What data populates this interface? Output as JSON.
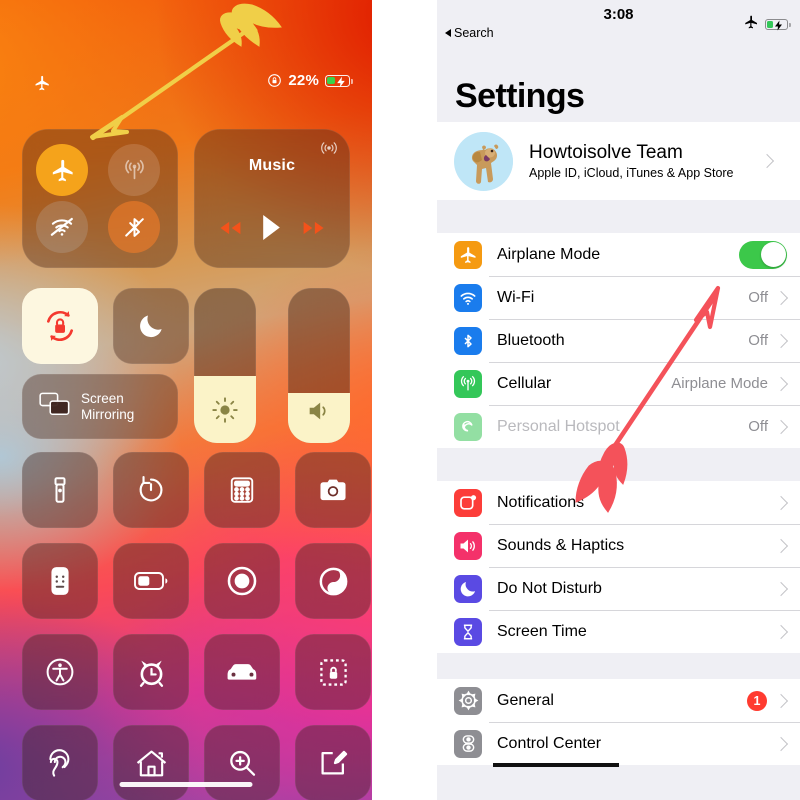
{
  "control_center": {
    "status_bar": {
      "airplane_icon": "airplane-icon",
      "orientation_lock_icon": "rotation-lock-icon",
      "battery_percent": "22%",
      "battery_icon": "battery-charging-icon"
    },
    "connectivity": {
      "airplane": {
        "name": "airplane-mode-toggle",
        "icon": "airplane-icon",
        "state": "on"
      },
      "cellular": {
        "name": "cellular-data-toggle",
        "icon": "cellular-antenna-icon",
        "state": "off"
      },
      "wifi": {
        "name": "wifi-toggle",
        "icon": "wifi-off-icon",
        "state": "off"
      },
      "bluetooth": {
        "name": "bluetooth-toggle",
        "icon": "bluetooth-off-icon",
        "state": "off"
      }
    },
    "music": {
      "title": "Music",
      "airplay_icon": "airplay-audio-icon",
      "rewind_icon": "rewind-icon",
      "play_icon": "play-icon",
      "forward_icon": "fast-forward-icon"
    },
    "tiles": {
      "rotation_lock": "rotation-lock-icon",
      "do_not_disturb": "moon-icon",
      "screen_mirroring_label_line1": "Screen",
      "screen_mirroring_label_line2": "Mirroring",
      "brightness_icon": "brightness-sun-icon",
      "volume_icon": "speaker-icon",
      "brightness_level": 43,
      "volume_level": 32
    },
    "grid": [
      {
        "name": "flashlight-tile",
        "icon": "flashlight-icon"
      },
      {
        "name": "timer-tile",
        "icon": "timer-icon"
      },
      {
        "name": "calculator-tile",
        "icon": "calculator-icon"
      },
      {
        "name": "camera-tile",
        "icon": "camera-icon"
      },
      {
        "name": "apple-tv-remote-tile",
        "icon": "remote-icon"
      },
      {
        "name": "low-power-mode-tile",
        "icon": "battery-icon"
      },
      {
        "name": "screen-record-tile",
        "icon": "record-icon"
      },
      {
        "name": "dark-mode-tile",
        "icon": "contrast-icon"
      },
      {
        "name": "accessibility-tile",
        "icon": "accessibility-icon"
      },
      {
        "name": "alarm-tile",
        "icon": "alarm-clock-icon"
      },
      {
        "name": "driving-focus-tile",
        "icon": "car-icon"
      },
      {
        "name": "guided-access-tile",
        "icon": "lock-dashed-icon"
      },
      {
        "name": "hearing-tile",
        "icon": "ear-icon"
      },
      {
        "name": "home-tile",
        "icon": "home-icon"
      },
      {
        "name": "magnifier-tile",
        "icon": "magnifier-plus-icon"
      },
      {
        "name": "notes-tile",
        "icon": "notes-pencil-icon"
      }
    ],
    "annotation": {
      "name": "yellow-arrow-annotation",
      "color": "#f2d24b",
      "points_to": "airplane-mode-toggle"
    },
    "home_indicator": "home-indicator"
  },
  "settings": {
    "status_bar": {
      "time": "3:08",
      "back_label": "Search",
      "airplane_icon": "airplane-icon",
      "battery_icon": "battery-charging-icon"
    },
    "page_title": "Settings",
    "account": {
      "name": "Howtoisolve Team",
      "subtitle": "Apple ID, iCloud, iTunes & App Store",
      "avatar": "giraffe-memoji-avatar"
    },
    "group_connectivity": [
      {
        "label": "Airplane Mode",
        "icon": "airplane-icon",
        "icon_color": "#f59a11",
        "control": "toggle",
        "toggle_on": true
      },
      {
        "label": "Wi-Fi",
        "icon": "wifi-icon",
        "icon_color": "#1a7ced",
        "value": "Off",
        "control": "chevron"
      },
      {
        "label": "Bluetooth",
        "icon": "bluetooth-icon",
        "icon_color": "#1a7ced",
        "value": "Off",
        "control": "chevron"
      },
      {
        "label": "Cellular",
        "icon": "cellular-antenna-icon",
        "icon_color": "#34c759",
        "value": "Airplane Mode",
        "control": "chevron"
      },
      {
        "label": "Personal Hotspot",
        "icon": "hotspot-icon",
        "icon_color": "#93dfa3",
        "value": "Off",
        "control": "chevron",
        "disabled": true
      }
    ],
    "group_notifications": [
      {
        "label": "Notifications",
        "icon": "notifications-icon",
        "icon_color": "#fc3d39",
        "control": "chevron"
      },
      {
        "label": "Sounds & Haptics",
        "icon": "speaker-icon",
        "icon_color": "#f4316a",
        "control": "chevron"
      },
      {
        "label": "Do Not Disturb",
        "icon": "moon-icon",
        "icon_color": "#5a4ae3",
        "control": "chevron"
      },
      {
        "label": "Screen Time",
        "icon": "hourglass-icon",
        "icon_color": "#5a4ae3",
        "control": "chevron"
      }
    ],
    "group_general": [
      {
        "label": "General",
        "icon": "gear-icon",
        "icon_color": "#8e8e93",
        "badge": "1",
        "control": "chevron"
      },
      {
        "label": "Control Center",
        "icon": "control-center-icon",
        "icon_color": "#8e8e93",
        "control": "chevron",
        "underlined": true
      }
    ],
    "annotation": {
      "name": "red-arrow-annotation",
      "color": "#f4525a",
      "points_to": "airplane-mode-toggle"
    }
  }
}
